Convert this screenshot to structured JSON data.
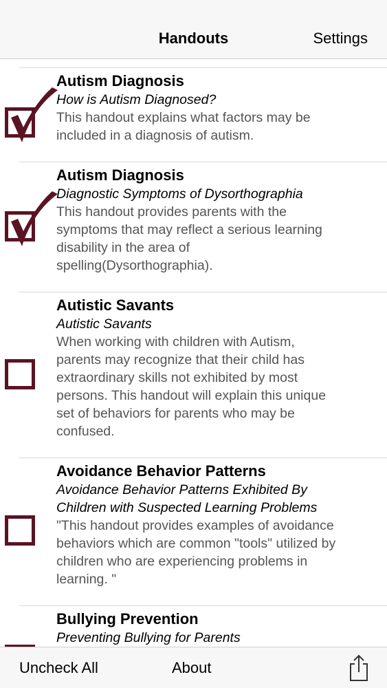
{
  "nav": {
    "title": "Handouts",
    "settings_label": "Settings"
  },
  "colors": {
    "checkbox": "#5a1424",
    "description_text": "#555555",
    "bar_background": "#f7f7f7"
  },
  "handouts": [
    {
      "title": "Autism Diagnosis",
      "subtitle": "How is Autism Diagnosed?",
      "description_lines": [
        "This handout explains what factors may be",
        "included in a diagnosis of autism."
      ],
      "checked": true
    },
    {
      "title": "Autism Diagnosis",
      "subtitle": "Diagnostic Symptoms of Dysorthographia",
      "description_lines": [
        "This handout provides parents with the",
        "symptoms that may reflect a serious learning",
        "disability in the area of",
        "spelling(Dysorthographia)."
      ],
      "checked": true
    },
    {
      "title": "Autistic Savants",
      "subtitle": "Autistic Savants",
      "description_lines": [
        "When working with children with Autism,",
        "parents may recognize that their child has",
        "extraordinary skills not exhibited by most",
        "persons. This handout will explain this unique",
        "set of behaviors for parents who may be",
        "confused."
      ],
      "checked": false
    },
    {
      "title": "Avoidance Behavior Patterns",
      "subtitle_lines": [
        "Avoidance Behavior Patterns Exhibited By",
        "Children with Suspected Learning Problems"
      ],
      "description_lines": [
        "\"This handout provides examples of avoidance",
        "behaviors which are common \"tools\" utilized by",
        "children who are experiencing problems in",
        "learning. \""
      ],
      "checked": false
    },
    {
      "title": "Bullying Prevention",
      "subtitle": "Preventing Bullying for Parents",
      "checked": false
    }
  ],
  "toolbar": {
    "uncheck_all_label": "Uncheck All",
    "about_label": "About",
    "share_icon": "share-icon"
  }
}
